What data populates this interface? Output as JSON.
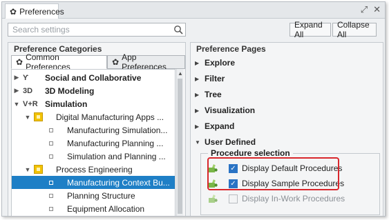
{
  "window": {
    "tab_label": "Preferences",
    "maximize_glyph": "⤢",
    "close_glyph": "✕"
  },
  "toolbar": {
    "search_placeholder": "Search settings",
    "expand_all": "Expand All",
    "collapse_all": "Collapse All"
  },
  "categories": {
    "title": "Preference Categories",
    "tabs": [
      {
        "label": "Common Preferences",
        "active": true
      },
      {
        "label": "App Preferences",
        "active": false
      }
    ],
    "tree": [
      {
        "label": "Social and Collaborative",
        "icon": "social-icon",
        "bold": true
      },
      {
        "label": "3D Modeling",
        "icon": "3d-icon",
        "icon_text": "3D",
        "bold": true
      },
      {
        "label": "Simulation",
        "icon": "vr-icon",
        "icon_text": "V+R",
        "bold": true
      },
      {
        "label": "Digital Manufacturing Apps ...",
        "icon": "app-folder-icon"
      },
      {
        "label": "Manufacturing Simulation..."
      },
      {
        "label": "Manufacturing Planning ..."
      },
      {
        "label": "Simulation and Planning ..."
      },
      {
        "label": "Process Engineering",
        "icon": "app-folder-icon"
      },
      {
        "label": "Manufacturing Context Bu...",
        "selected": true
      },
      {
        "label": "Planning Structure"
      },
      {
        "label": "Equipment Allocation"
      }
    ]
  },
  "pages": {
    "title": "Preference Pages",
    "items": [
      "Explore",
      "Filter",
      "Tree",
      "Visualization",
      "Expand",
      "User Defined"
    ],
    "group": {
      "title": "Procedure selection",
      "options": [
        {
          "label": "Display Default Procedures",
          "checked": true,
          "enabled": true
        },
        {
          "label": "Display Sample Procedures",
          "checked": true,
          "enabled": true
        },
        {
          "label": "Display In-Work Procedures",
          "checked": false,
          "enabled": false
        }
      ]
    }
  },
  "colors": {
    "selection": "#1e7fc6",
    "highlight": "#d9262b",
    "checkbox": "#2a73c4"
  }
}
